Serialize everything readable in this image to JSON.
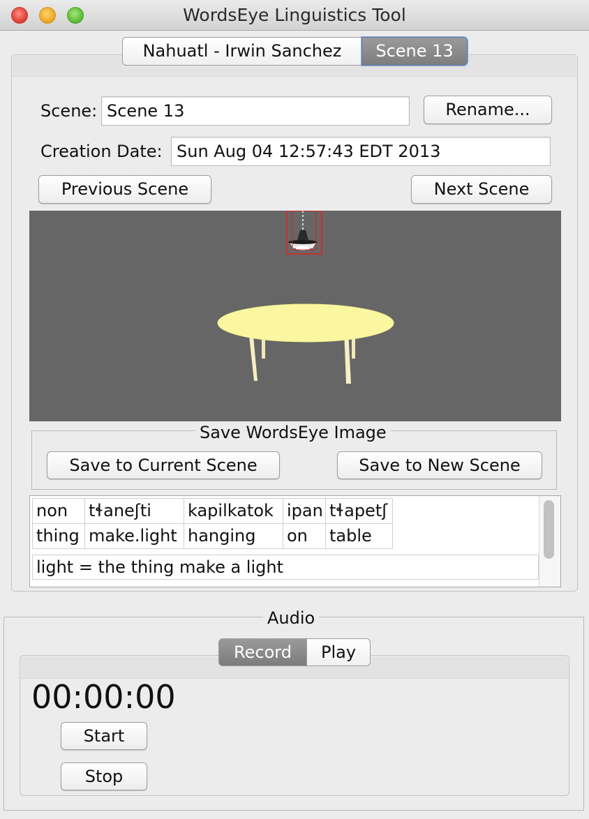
{
  "window": {
    "title": "WordsEye Linguistics Tool"
  },
  "tabs": [
    {
      "label": "Nahuatl - Irwin Sanchez",
      "selected": false
    },
    {
      "label": "Scene 13",
      "selected": true
    }
  ],
  "scene": {
    "scene_label": "Scene:",
    "scene_name": "Scene 13",
    "rename_label": "Rename...",
    "date_label": "Creation Date:",
    "date_value": "Sun Aug 04 12:57:43 EDT 2013",
    "previous_label": "Previous Scene",
    "next_label": "Next Scene"
  },
  "save": {
    "title": "Save WordsEye Image",
    "current_label": "Save to Current Scene",
    "new_label": "Save to New Scene"
  },
  "gloss": {
    "words": [
      "non",
      "tɬaneʃti",
      "kapilkatok",
      "ipan",
      "tɬapetʃ"
    ],
    "glosses": [
      "thing",
      "make.light",
      "hanging",
      "on",
      "table"
    ],
    "translation": "light = the thing make a light"
  },
  "audio": {
    "title": "Audio",
    "tabs": [
      {
        "label": "Record",
        "selected": true
      },
      {
        "label": "Play",
        "selected": false
      }
    ],
    "timer": "00:00:00",
    "start_label": "Start",
    "stop_label": "Stop"
  },
  "colors": {
    "viewport_bg": "#666666",
    "tabletop": "#fbf7a0",
    "selection": "#e0201e"
  }
}
